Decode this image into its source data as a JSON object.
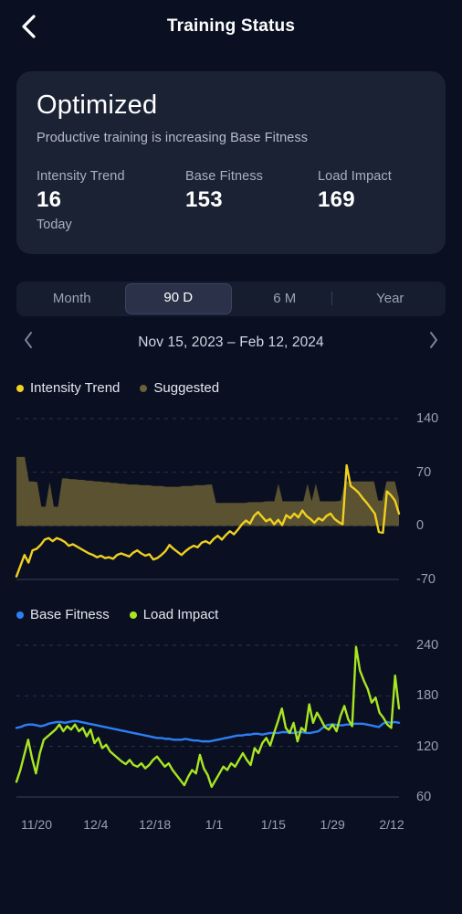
{
  "header": {
    "title": "Training Status",
    "back_icon": "chevron-left-icon"
  },
  "status_card": {
    "title": "Optimized",
    "subtitle": "Productive training is increasing Base Fitness",
    "metrics": [
      {
        "label": "Intensity Trend",
        "value": "16",
        "note": "Today"
      },
      {
        "label": "Base Fitness",
        "value": "153",
        "note": ""
      },
      {
        "label": "Load Impact",
        "value": "169",
        "note": ""
      }
    ]
  },
  "range_selector": {
    "options": [
      "Month",
      "90 D",
      "6 M",
      "Year"
    ],
    "selected": "90 D"
  },
  "date_nav": {
    "prev_icon": "chevron-left-icon",
    "next_icon": "chevron-right-icon",
    "range": "Nov 15, 2023 – Feb 12, 2024"
  },
  "colors": {
    "page_bg": "#0a1022",
    "card_bg": "#1b2234",
    "intensity_trend": "#f0d020",
    "suggested": "#5a5230",
    "base_fitness": "#2d7ff5",
    "load_impact": "#a8e621",
    "grid": "#2b3348",
    "axis_text": "#99a0b1"
  },
  "chart_data": [
    {
      "type": "line",
      "title": "Intensity Trend",
      "xlabel": "",
      "ylabel": "",
      "ylim": [
        -70,
        140
      ],
      "yticks": [
        140,
        70,
        0,
        -70
      ],
      "grid": true,
      "legend_position": "top-left",
      "legend": [
        {
          "name": "Intensity Trend",
          "color": "#f0d020",
          "marker": "dot"
        },
        {
          "name": "Suggested",
          "color": "#5a5230",
          "marker": "dot"
        }
      ],
      "x_start": "11/15",
      "x_end": "2/12",
      "series": [
        {
          "name": "Suggested",
          "type": "area",
          "color": "#5a5230",
          "baseline": 0,
          "values": [
            90,
            90,
            90,
            58,
            58,
            57,
            25,
            25,
            57,
            25,
            25,
            62,
            62,
            61,
            61,
            60,
            60,
            59,
            59,
            58,
            58,
            57,
            57,
            56,
            56,
            55,
            55,
            54,
            54,
            54,
            53,
            53,
            53,
            52,
            52,
            52,
            51,
            51,
            51,
            51,
            52,
            52,
            52,
            53,
            53,
            53,
            54,
            54,
            30,
            30,
            30,
            30,
            30,
            30,
            30,
            30,
            31,
            31,
            31,
            31,
            32,
            32,
            32,
            55,
            32,
            32,
            32,
            32,
            32,
            32,
            55,
            32,
            55,
            32,
            32,
            32,
            32,
            32,
            33,
            58,
            58,
            58,
            58,
            58,
            58,
            58,
            58,
            33,
            33,
            58,
            58,
            58,
            35
          ]
        },
        {
          "name": "Intensity Trend",
          "type": "line",
          "color": "#f0d020",
          "values": [
            -66,
            -52,
            -38,
            -48,
            -32,
            -30,
            -25,
            -18,
            -16,
            -20,
            -16,
            -18,
            -21,
            -26,
            -24,
            -27,
            -30,
            -33,
            -36,
            -38,
            -41,
            -39,
            -42,
            -41,
            -43,
            -38,
            -36,
            -38,
            -40,
            -35,
            -32,
            -36,
            -39,
            -37,
            -44,
            -42,
            -38,
            -33,
            -25,
            -30,
            -34,
            -38,
            -33,
            -29,
            -26,
            -28,
            -22,
            -20,
            -23,
            -17,
            -13,
            -18,
            -12,
            -7,
            -11,
            -5,
            2,
            7,
            3,
            13,
            18,
            12,
            6,
            9,
            2,
            8,
            1,
            14,
            10,
            16,
            11,
            20,
            13,
            9,
            4,
            10,
            7,
            13,
            16,
            9,
            5,
            2,
            79,
            52,
            48,
            43,
            36,
            30,
            23,
            16,
            -8,
            -9,
            45,
            40,
            33,
            16
          ]
        }
      ]
    },
    {
      "type": "line",
      "title": "Base Fitness / Load Impact",
      "xlabel": "",
      "ylabel": "",
      "ylim": [
        60,
        240
      ],
      "yticks": [
        240,
        180,
        120,
        60
      ],
      "grid": true,
      "legend_position": "top-left",
      "legend": [
        {
          "name": "Base Fitness",
          "color": "#2d7ff5",
          "marker": "dot"
        },
        {
          "name": "Load Impact",
          "color": "#a8e621",
          "marker": "dot"
        }
      ],
      "xticks": [
        "11/20",
        "12/4",
        "12/18",
        "1/1",
        "1/15",
        "1/29",
        "2/12"
      ],
      "series": [
        {
          "name": "Base Fitness",
          "type": "line",
          "color": "#2d7ff5",
          "values": [
            142,
            143,
            145,
            146,
            146,
            145,
            144,
            145,
            147,
            148,
            149,
            149,
            148,
            149,
            150,
            150,
            149,
            148,
            147,
            146,
            145,
            144,
            143,
            142,
            141,
            140,
            139,
            138,
            137,
            136,
            135,
            134,
            133,
            132,
            131,
            130,
            130,
            129,
            129,
            128,
            128,
            128,
            129,
            128,
            127,
            127,
            126,
            126,
            126,
            127,
            128,
            129,
            130,
            131,
            132,
            133,
            133,
            134,
            134,
            135,
            135,
            134,
            135,
            136,
            136,
            136,
            137,
            137,
            136,
            136,
            137,
            137,
            136,
            136,
            137,
            138,
            142,
            145,
            146,
            146,
            145,
            145,
            146,
            146,
            147,
            147,
            147,
            146,
            145,
            144,
            143,
            147,
            149,
            148,
            149,
            148
          ]
        },
        {
          "name": "Load Impact",
          "type": "line",
          "color": "#a8e621",
          "values": [
            78,
            92,
            110,
            128,
            106,
            88,
            112,
            128,
            132,
            136,
            140,
            146,
            138,
            144,
            140,
            146,
            138,
            142,
            132,
            140,
            124,
            130,
            118,
            122,
            114,
            110,
            106,
            102,
            99,
            104,
            98,
            96,
            100,
            94,
            98,
            104,
            108,
            102,
            96,
            100,
            92,
            86,
            80,
            74,
            84,
            92,
            88,
            110,
            94,
            86,
            72,
            80,
            88,
            96,
            92,
            100,
            96,
            104,
            112,
            104,
            98,
            118,
            112,
            124,
            130,
            121,
            136,
            150,
            165,
            142,
            136,
            148,
            126,
            142,
            138,
            170,
            148,
            160,
            152,
            143,
            140,
            146,
            138,
            156,
            168,
            152,
            144,
            238,
            210,
            198,
            188,
            172,
            178,
            160,
            154,
            146,
            142,
            204,
            165
          ]
        }
      ]
    }
  ]
}
